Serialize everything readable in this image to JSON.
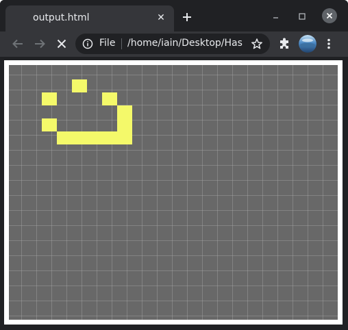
{
  "browser": {
    "tab_title": "output.html",
    "tab_close_glyph": "✕",
    "new_tab_icon": "plus-icon",
    "window_controls": [
      "minimize-icon",
      "maximize-icon",
      "close-icon"
    ],
    "address_bar": {
      "scheme_label": "File",
      "url": "/home/iain/Desktop/Has...",
      "info_icon": "info-icon",
      "bookmark_icon": "star-icon"
    },
    "toolbar_icons": [
      "back-arrow-icon",
      "forward-arrow-icon",
      "stop-loading-icon",
      "puzzle-icon",
      "profile-avatar",
      "kebab-menu-icon"
    ]
  },
  "game": {
    "grid_columns": 21,
    "grid_rows": 19,
    "cell_color": "#f4f96a",
    "board_color": "#686868",
    "grid_line_color": "#9a9a9a",
    "live_cells": [
      [
        4,
        1
      ],
      [
        2,
        2
      ],
      [
        6,
        2
      ],
      [
        7,
        3
      ],
      [
        2,
        4
      ],
      [
        7,
        4
      ],
      [
        3,
        5
      ],
      [
        4,
        5
      ],
      [
        5,
        5
      ],
      [
        6,
        5
      ],
      [
        7,
        5
      ]
    ]
  }
}
